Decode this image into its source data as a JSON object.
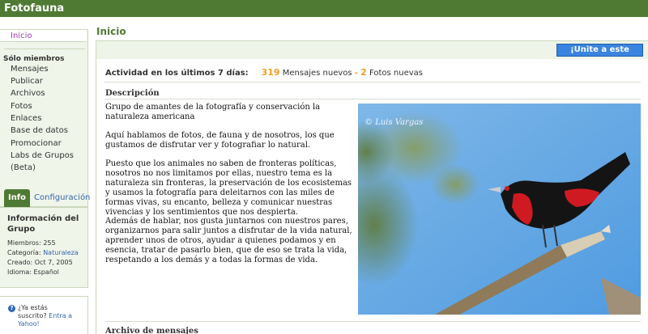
{
  "app": {
    "title": "Fotofauna"
  },
  "page": {
    "title": "Inicio"
  },
  "sidebar": {
    "home": "Inicio",
    "members_heading": "Sólo miembros",
    "items": [
      "Mensajes",
      "Publicar",
      "Archivos",
      "Fotos",
      "Enlaces",
      "Base de datos",
      "Promocionar",
      "Labs de Grupos",
      "(Beta)"
    ]
  },
  "info_panel": {
    "tabs": [
      "Info",
      "Configuración"
    ],
    "title": "Información del Grupo",
    "members_label": "Miembros:",
    "members_value": "255",
    "category_label": "Categoría:",
    "category_value": "Naturaleza",
    "created_label": "Creado:",
    "created_value": "Oct 7, 2005",
    "language_label": "Idioma:",
    "language_value": "Español"
  },
  "yahoo": {
    "question": "¿Ya estás suscrito?",
    "link": "Entra a Yahoo!"
  },
  "join_button": "¡Unite a este grupo!",
  "activity": {
    "label": "Actividad en los últimos 7 días:",
    "messages_count": "319",
    "messages_label": "Mensajes nuevos",
    "separator": "-",
    "photos_count": "2",
    "photos_label": "Fotos nuevas"
  },
  "description": {
    "heading": "Descripción",
    "paragraphs": [
      "Grupo de amantes de la fotografía y conservación la naturaleza americana",
      "Aquí hablamos de fotos, de fauna y de nosotros, los que gustamos de disfrutar ver y fotografiar lo natural.",
      "Puesto que los animales no saben de fronteras políticas, nosotros no nos limitamos por ellas, nuestro tema es la naturaleza sin fronteras, la preservación de los ecosistemas y usamos la fotografía para deleitarnos con las miles de formas vivas, su encanto, belleza y comunicar nuestras vivencias y los sentimientos que nos despierta.",
      "Además de hablar, nos gusta juntarnos con nuestros pares, organizarnos para salir juntos a disfrutar de la vida natural, aprender unos de otros, ayudar a quienes podamos y en esencia, tratar de pasarlo bien, que de eso se trata la vida, respetando a los demás y a todas la formas de vida."
    ],
    "photo_watermark": "© Luis Vargas"
  },
  "archive": {
    "heading": "Archivo de mensajes"
  },
  "colors": {
    "brand_green": "#4f7a33",
    "join_blue": "#3a84e0",
    "activity_orange": "#f0a020",
    "link_blue": "#3366aa"
  }
}
